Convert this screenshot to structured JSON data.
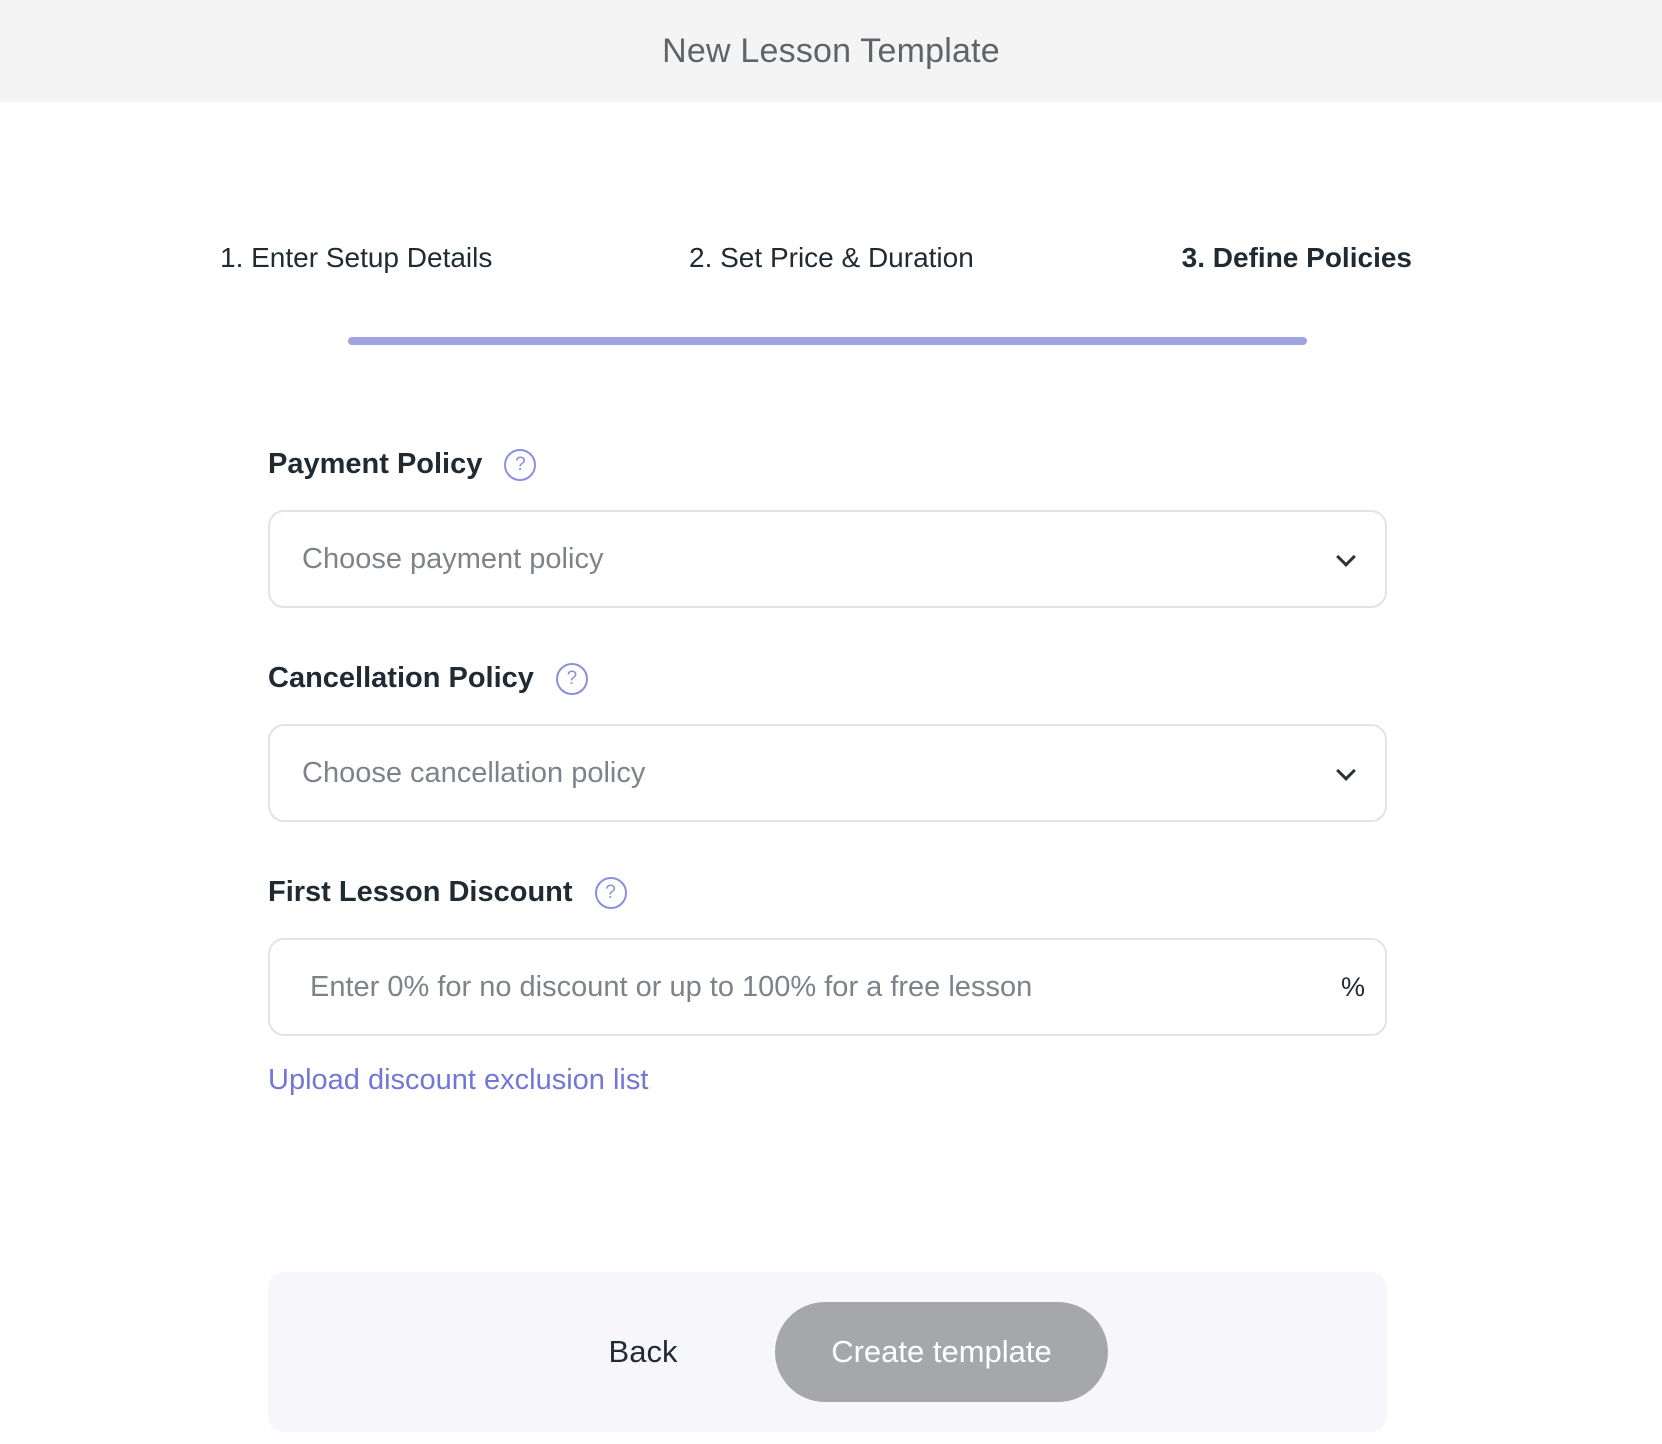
{
  "header": {
    "title": "New Lesson Template"
  },
  "steps": [
    {
      "label": "1. Enter Setup Details",
      "active": false
    },
    {
      "label": "2. Set Price & Duration",
      "active": false
    },
    {
      "label": "3. Define Policies",
      "active": true
    }
  ],
  "progress": {
    "percent": 100,
    "fill_color": "#9ea3e4"
  },
  "form": {
    "payment_policy": {
      "label": "Payment Policy",
      "help_icon": "?",
      "placeholder": "Choose payment policy"
    },
    "cancellation_policy": {
      "label": "Cancellation Policy",
      "help_icon": "?",
      "placeholder": "Choose cancellation policy"
    },
    "first_lesson_discount": {
      "label": "First Lesson Discount",
      "help_icon": "?",
      "placeholder": "Enter 0% for no discount or up to 100% for a free lesson",
      "value": "",
      "suffix": "%"
    },
    "upload_link": "Upload discount exclusion list"
  },
  "footer": {
    "back_label": "Back",
    "create_label": "Create template",
    "create_color": "#a6a7ab"
  },
  "colors": {
    "accent": "#7177d6",
    "help_icon": "#8a8fe0",
    "header_bg": "#f4f4f4"
  }
}
